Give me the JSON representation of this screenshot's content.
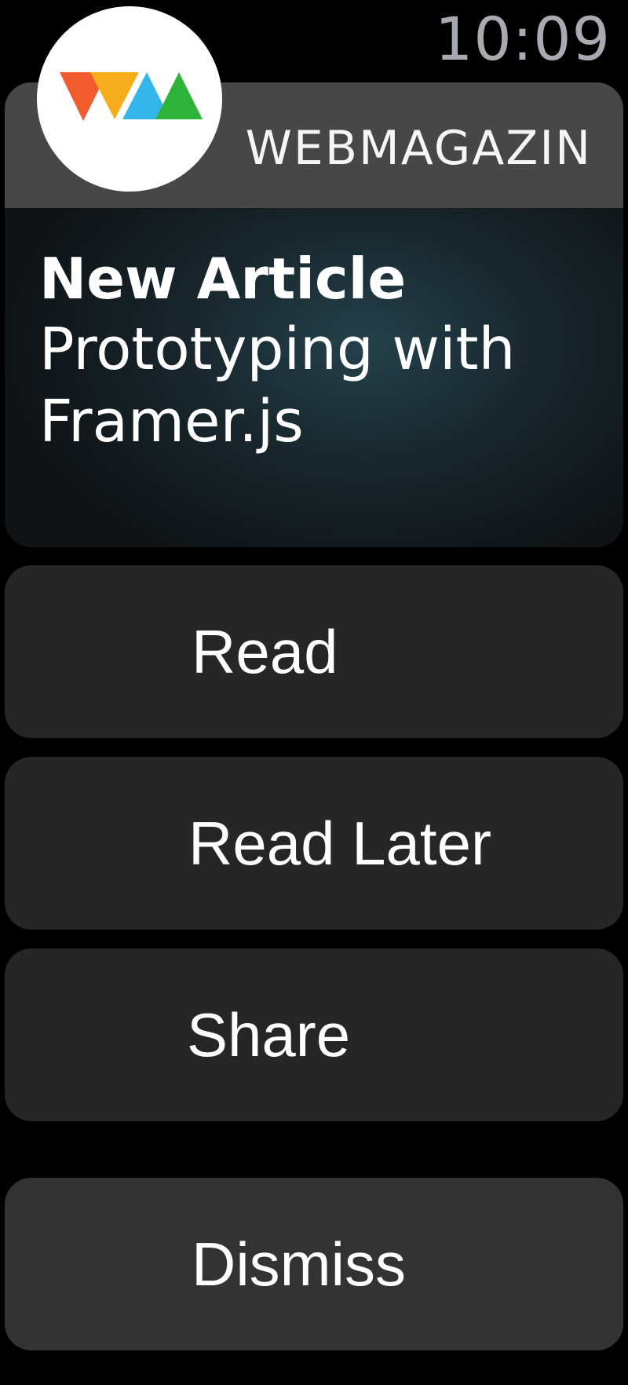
{
  "status_bar": {
    "time": "10:09"
  },
  "notification": {
    "app_name": "WEBMAGAZIN",
    "app_icon": "webmagazin-wm-logo",
    "title": "New Article",
    "body": "Prototyping with Framer.js"
  },
  "actions": {
    "read": "Read",
    "read_later": "Read Later",
    "share": "Share",
    "dismiss": "Dismiss"
  },
  "colors": {
    "background": "#000000",
    "time": "#a7aab0",
    "card_header": "#474747",
    "button": "#262626",
    "dismiss_button": "#333333",
    "logo_red": "#f15b2e",
    "logo_orange": "#f6ad1b",
    "logo_blue": "#35b6ea",
    "logo_green": "#2fb43a"
  }
}
